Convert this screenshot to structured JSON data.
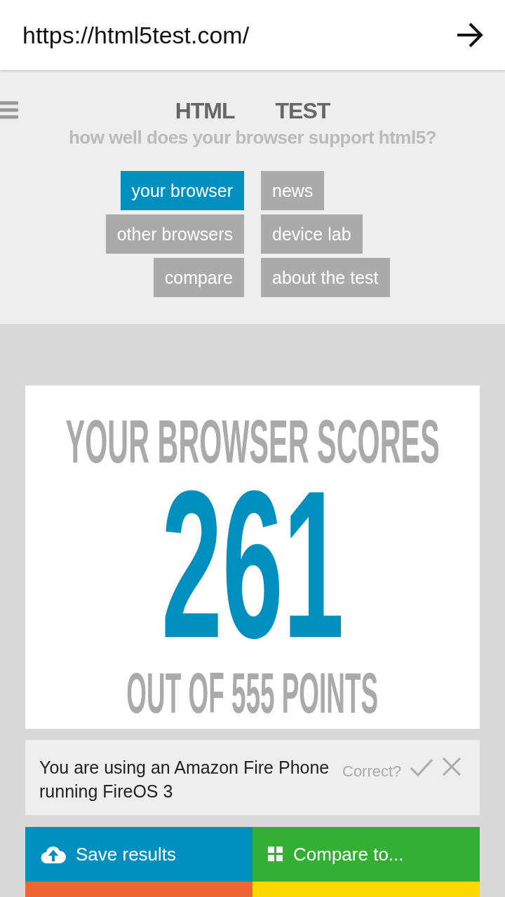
{
  "address_bar": {
    "url": "https://html5test.com/"
  },
  "header": {
    "logo": [
      "HTML",
      "TEST"
    ],
    "tagline": "how well does your browser support html5?"
  },
  "nav": [
    {
      "label": "your browser",
      "selected": true
    },
    {
      "label": "news",
      "selected": false
    },
    {
      "label": "other browsers",
      "selected": false
    },
    {
      "label": "device lab",
      "selected": false
    },
    {
      "label": "compare",
      "selected": false
    },
    {
      "label": "about the test",
      "selected": false
    }
  ],
  "score": {
    "heading": "YOUR BROWSER SCORES",
    "value": "261",
    "total": "OUT OF 555 POINTS"
  },
  "detection": {
    "text": "You are using an Amazon Fire Phone running FireOS 3",
    "question": "Correct?"
  },
  "actions": [
    {
      "kind": "save",
      "label": "Save results",
      "color": "#0090c0"
    },
    {
      "kind": "compare",
      "label": "Compare to...",
      "color": "#33b033"
    },
    {
      "kind": "blank",
      "color": "#ec6535"
    },
    {
      "kind": "blank",
      "color": "#ffd800"
    }
  ]
}
